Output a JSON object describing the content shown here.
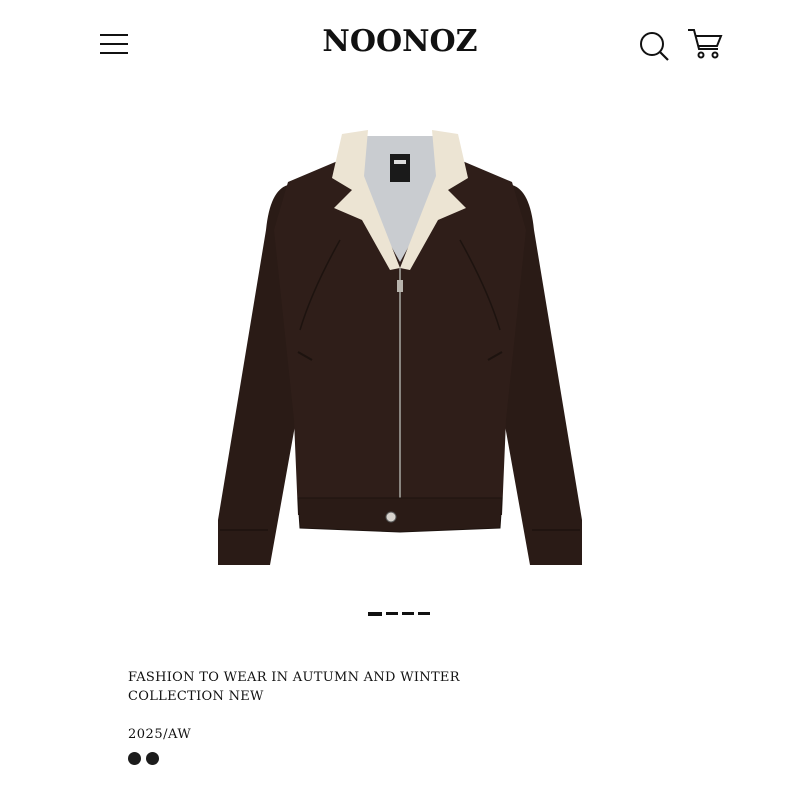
{
  "header": {
    "brand": "NOONOZ",
    "icons": {
      "menu": "hamburger-menu-icon",
      "search": "search-icon",
      "cart": "cart-icon"
    }
  },
  "product": {
    "image_alt": "jacket-icon",
    "gallery": {
      "total": 4,
      "current": 1
    },
    "headline": "FASHION TO WEAR IN AUTUMN AND WINTER COLLECTION NEW",
    "season": "2025/AW",
    "swatches": [
      {
        "color": "#1c1c1c"
      },
      {
        "color": "#1c1c1c"
      }
    ]
  },
  "colors": {
    "body": "#2a1b16",
    "collar": "#ece4d3",
    "lining": "#c9ccd0"
  }
}
